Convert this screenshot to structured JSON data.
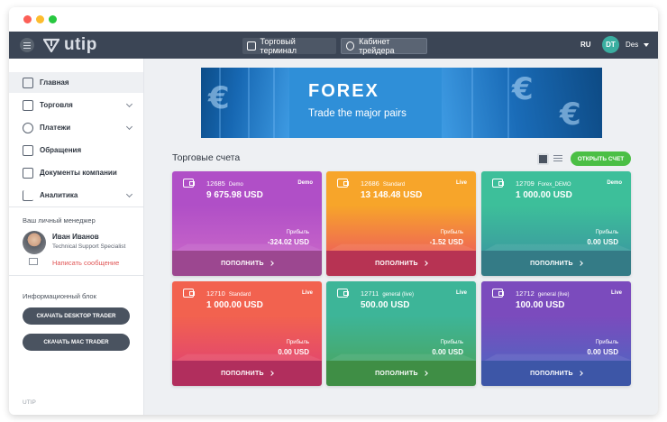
{
  "window": {
    "controls": [
      "close",
      "minimize",
      "maximize"
    ]
  },
  "topbar": {
    "logo_text": "utip",
    "terminal_label": "Торговый терминал",
    "cabinet_label": "Кабинет трейдера",
    "language": "RU",
    "user_initials": "DT",
    "user_name": "Des"
  },
  "sidebar": {
    "items": [
      {
        "label": "Главная",
        "icon": "home-icon",
        "active": true
      },
      {
        "label": "Торговля",
        "icon": "wallet-icon",
        "has_submenu": true
      },
      {
        "label": "Платежи",
        "icon": "dollar-icon",
        "has_submenu": true
      },
      {
        "label": "Обращения",
        "icon": "chat-icon"
      },
      {
        "label": "Документы компании",
        "icon": "document-icon"
      },
      {
        "label": "Аналитика",
        "icon": "chart-icon",
        "has_submenu": true
      }
    ],
    "manager_heading": "Ваш личный менеджер",
    "manager_name": "Иван Иванов",
    "manager_role": "Technical Support Specialist",
    "manager_message": "Написать сообщение",
    "info_heading": "Информационный блок",
    "download_desktop": "СКАЧАТЬ DESKTOP TRADER",
    "download_mac": "СКАЧАТЬ MAC TRADER",
    "footer": "UTIP"
  },
  "banner": {
    "title": "FOREX",
    "subtitle": "Trade the major pairs"
  },
  "accounts": {
    "title": "Торговые счета",
    "open_button": "ОТКРЫТЬ СЧЕТ",
    "profit_label": "Прибыль",
    "deposit_label": "ПОПОЛНИТЬ",
    "cards": [
      {
        "number": "12685",
        "type": "Demo",
        "status": "Demo",
        "balance": "9 675.98 USD",
        "profit": "-324.02 USD",
        "colors": {
          "top": "#b04fc7",
          "mid": "#c462c8",
          "bottom": "#9c4790"
        }
      },
      {
        "number": "12686",
        "type": "Standard",
        "status": "Live",
        "balance": "13 148.48 USD",
        "profit": "-1.52 USD",
        "colors": {
          "top": "#f7a52a",
          "mid": "#ef6a52",
          "bottom": "#b73353"
        }
      },
      {
        "number": "12709",
        "type": "Forex_DEMO",
        "status": "Demo",
        "balance": "1 000.00 USD",
        "profit": "0.00 USD",
        "colors": {
          "top": "#3dbf9a",
          "mid": "#3b9f9e",
          "bottom": "#347b86"
        }
      },
      {
        "number": "12710",
        "type": "Standard",
        "status": "Live",
        "balance": "1 000.00 USD",
        "profit": "0.00 USD",
        "colors": {
          "top": "#f2624f",
          "mid": "#e44a6a",
          "bottom": "#b12e5d"
        }
      },
      {
        "number": "12711",
        "type": "general (live)",
        "status": "Live",
        "balance": "500.00 USD",
        "profit": "0.00 USD",
        "colors": {
          "top": "#3db598",
          "mid": "#47a96e",
          "bottom": "#3f8e45"
        }
      },
      {
        "number": "12712",
        "type": "general (live)",
        "status": "Live",
        "balance": "100.00 USD",
        "profit": "0.00 USD",
        "colors": {
          "top": "#7b4bbd",
          "mid": "#5a5fc0",
          "bottom": "#3d56a7"
        }
      }
    ]
  }
}
